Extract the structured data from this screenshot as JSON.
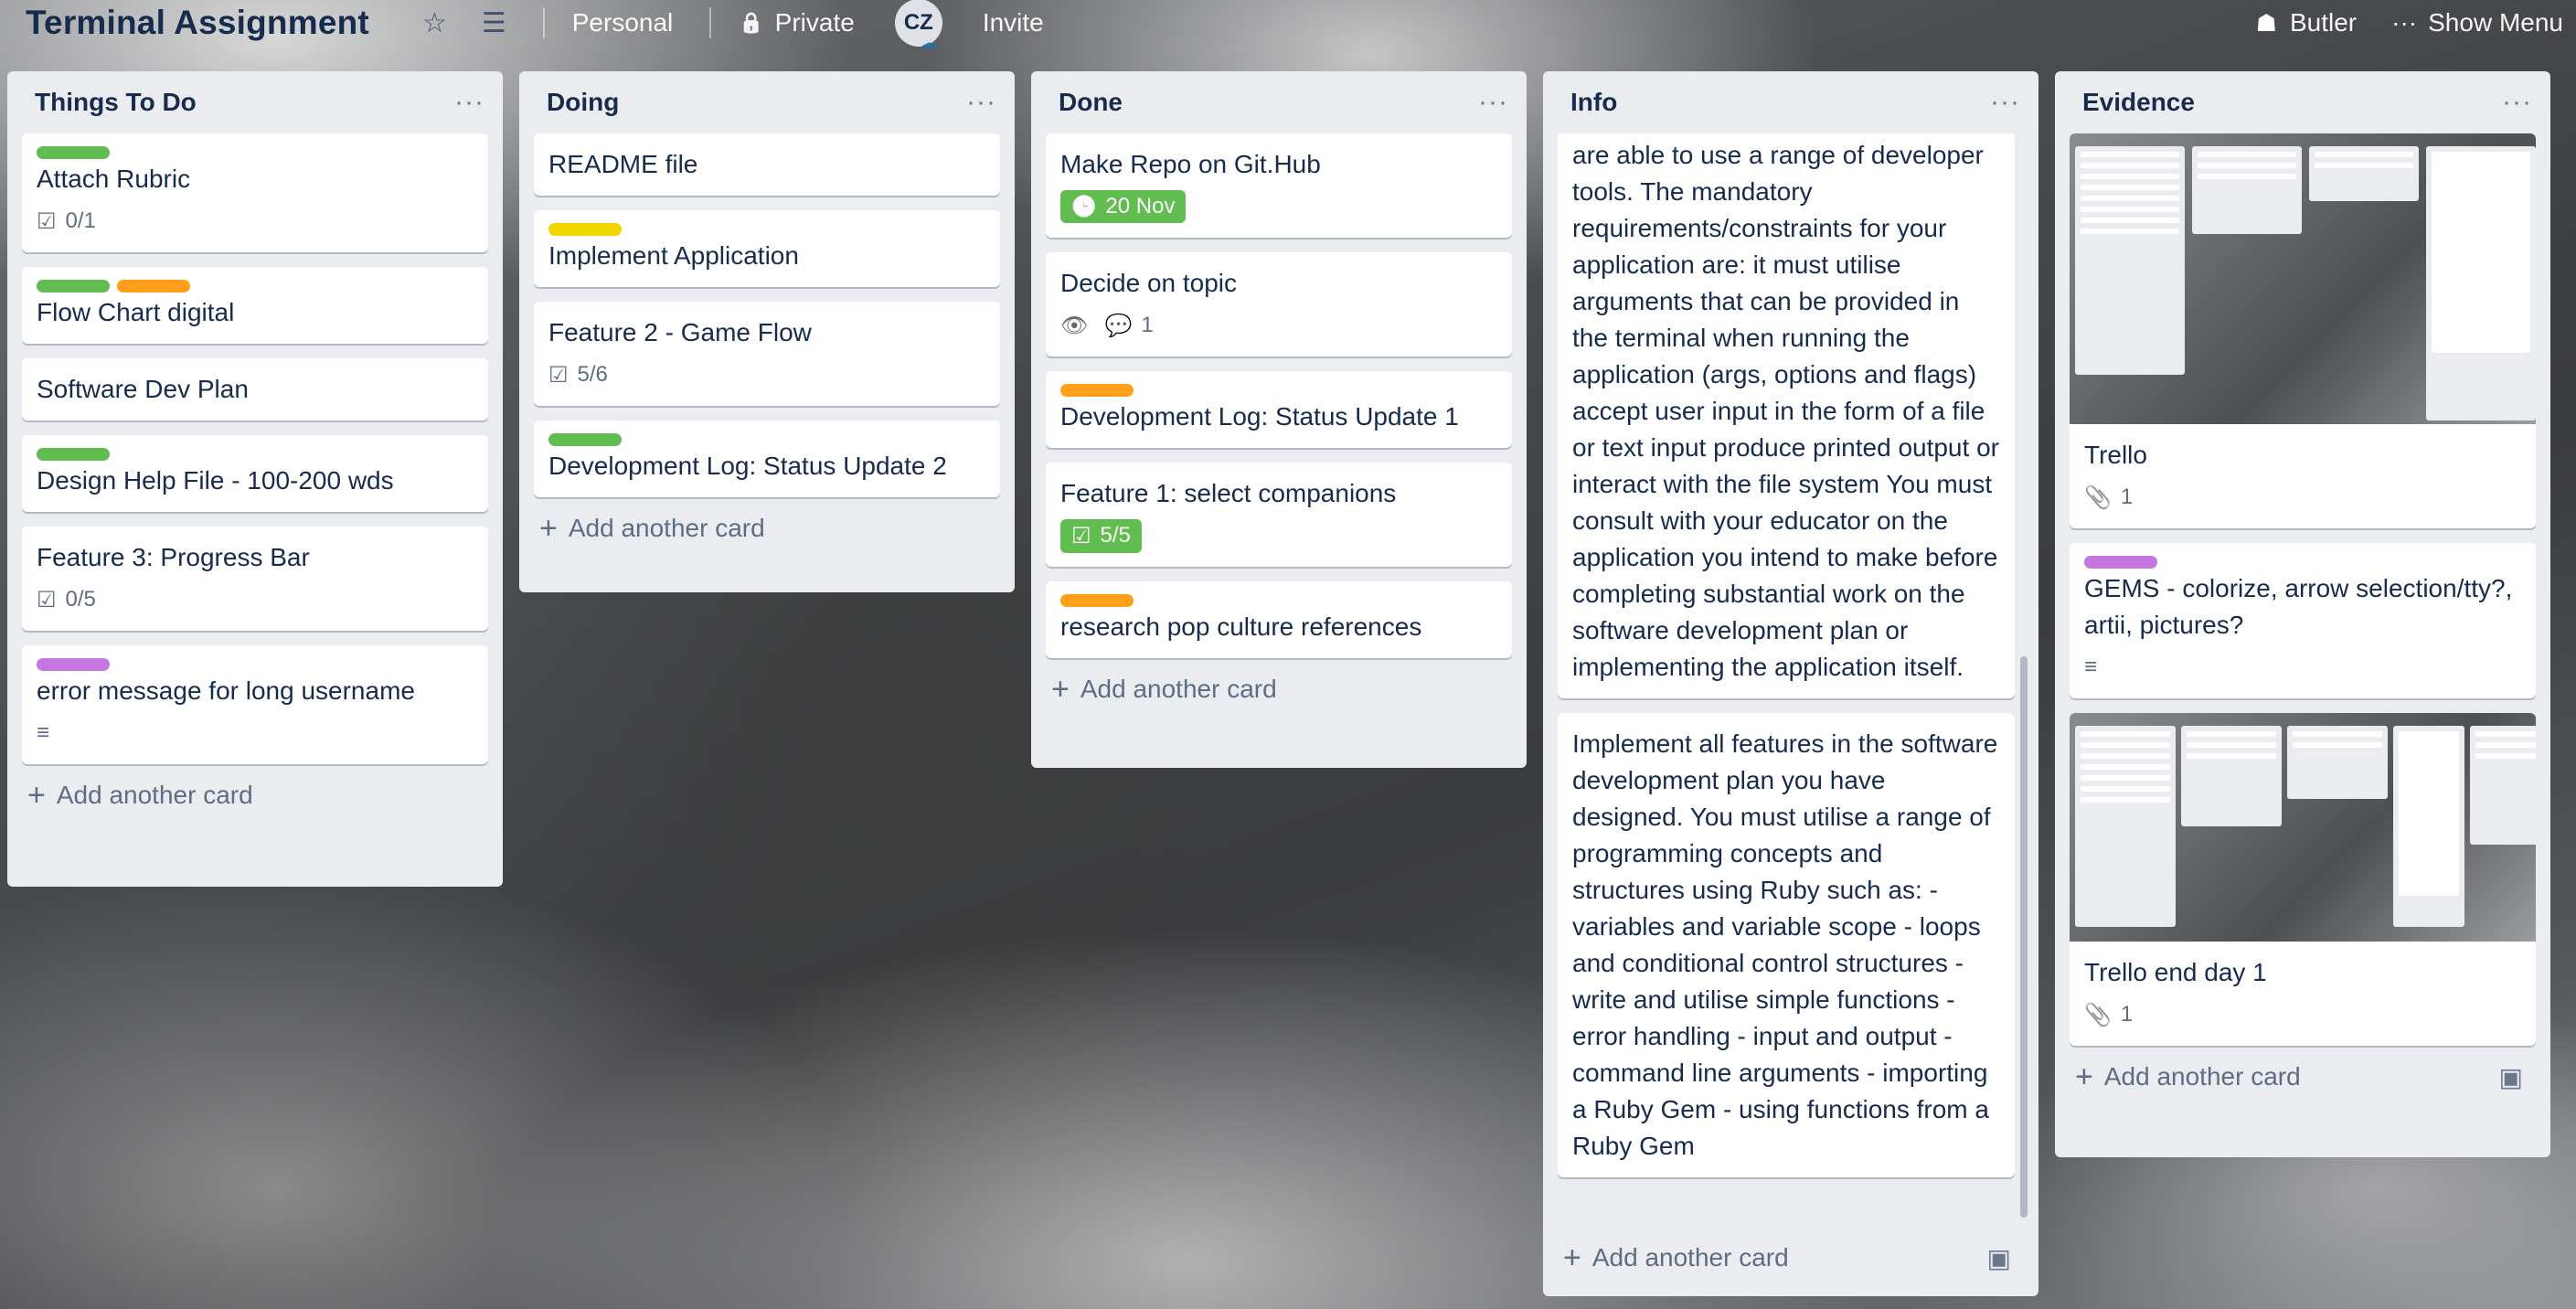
{
  "board": {
    "title": "Terminal Assignment",
    "personal_label": "Personal",
    "private_label": "Private",
    "avatar_initials": "CZ",
    "invite_label": "Invite",
    "butler_label": "Butler",
    "show_menu_label": "Show Menu"
  },
  "icons": {
    "star": "☆",
    "menu": "☰",
    "lock": "🔒",
    "butler": "☗",
    "dots": "···",
    "checklist": "☑",
    "clock": "🕒",
    "eye": "👁",
    "comment": "💬",
    "paperclip": "📎",
    "description": "≡",
    "plus": "+",
    "template": "▣"
  },
  "label_colors": {
    "green": "#61bd4f",
    "orange": "#ff9f1a",
    "yellow": "#f2d600",
    "purple": "#c377e0"
  },
  "add_card_label": "Add another card",
  "lists": {
    "todo": {
      "title": "Things To Do",
      "cards": [
        {
          "title": "Attach Rubric",
          "checklist": "0/1"
        },
        {
          "title": "Flow Chart digital"
        },
        {
          "title": "Software Dev Plan"
        },
        {
          "title": "Design Help File - 100-200 wds"
        },
        {
          "title": "Feature 3: Progress Bar",
          "checklist": "0/5"
        },
        {
          "title": "error message for long username"
        }
      ]
    },
    "doing": {
      "title": "Doing",
      "cards": [
        {
          "title": "README file"
        },
        {
          "title": "Implement Application"
        },
        {
          "title": "Feature 2 - Game Flow",
          "checklist": "5/6"
        },
        {
          "title": "Development Log: Status Update 2"
        }
      ]
    },
    "done": {
      "title": "Done",
      "cards": [
        {
          "title": "Make Repo on Git.Hub",
          "due": "20 Nov"
        },
        {
          "title": "Decide on topic",
          "comments": "1"
        },
        {
          "title": "Development Log: Status Update 1"
        },
        {
          "title": "Feature 1: select companions",
          "checklist": "5/5"
        },
        {
          "title": "research pop culture references"
        }
      ]
    },
    "info": {
      "title": "Info",
      "cards": [
        {
          "text": "are able to use a range of developer tools. The mandatory requirements/constraints for your application are: it must utilise arguments that can be provided in the terminal when running the application (args, options and flags) accept user input in the form of a file or text input produce printed output or interact with the file system You must consult with your educator on the application you intend to make before completing substantial work on the software development plan or implementing the application itself."
        },
        {
          "text": "Implement all features in the software development plan you have designed. You must utilise a range of programming concepts and structures using Ruby such as: - variables and variable scope - loops and conditional control structures - write and utilise simple functions - error handling - input and output - command line arguments - importing a Ruby Gem - using functions from a Ruby Gem"
        }
      ]
    },
    "evidence": {
      "title": "Evidence",
      "cards": [
        {
          "title": "Trello",
          "attachments": "1"
        },
        {
          "title": "GEMS - colorize, arrow selection/tty?, artii, pictures?"
        },
        {
          "title": "Trello end day 1",
          "attachments": "1"
        }
      ]
    }
  }
}
